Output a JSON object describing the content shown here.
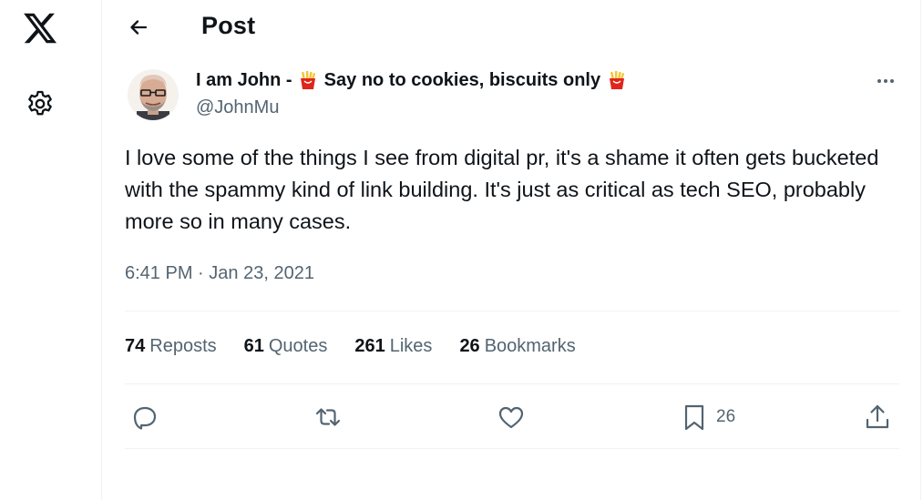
{
  "header": {
    "title": "Post"
  },
  "author": {
    "name_prefix": "I am John - ",
    "name_middle": " Say no to cookies, biscuits only ",
    "handle": "@JohnMu",
    "emoji_icon": "french-fries-icon"
  },
  "tweet": {
    "text": "I love some of the things I see from digital pr, it's a shame it often gets bucketed with the spammy kind of link building. It's just as critical as tech SEO, probably more so in many cases.",
    "time": "6:41 PM",
    "separator": "·",
    "date": "Jan 23, 2021"
  },
  "stats": [
    {
      "count": "74",
      "label": "Reposts"
    },
    {
      "count": "61",
      "label": "Quotes"
    },
    {
      "count": "261",
      "label": "Likes"
    },
    {
      "count": "26",
      "label": "Bookmarks"
    }
  ],
  "actions": {
    "reply_icon": "reply-icon",
    "repost_icon": "repost-icon",
    "like_icon": "heart-icon",
    "bookmark_icon": "bookmark-icon",
    "bookmark_count": "26",
    "share_icon": "share-icon"
  },
  "colors": {
    "text": "#0f1419",
    "secondary": "#536471",
    "divider": "#eff3f4"
  }
}
